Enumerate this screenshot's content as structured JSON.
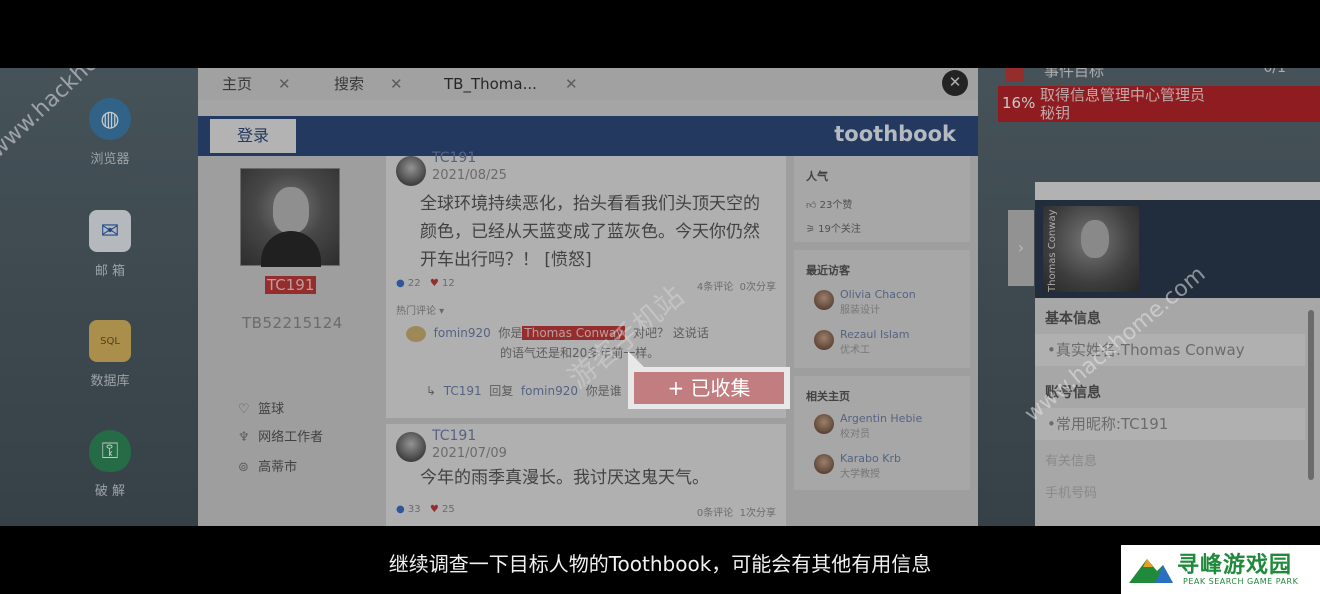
{
  "desktop": {
    "icons": [
      {
        "label": "浏览器"
      },
      {
        "label": "邮 箱"
      },
      {
        "label": "数据库"
      },
      {
        "label": "破 解"
      }
    ]
  },
  "browser": {
    "tabs": [
      {
        "label": "主页"
      },
      {
        "label": "搜索"
      },
      {
        "label": "TB_Thoma..."
      }
    ],
    "close_symbol": "✕",
    "login_label": "登录",
    "brand": "toothbook"
  },
  "profile": {
    "username": "TC191",
    "user_id": "TB52215124",
    "attributes": [
      {
        "icon": "heart-icon",
        "glyph": "♡",
        "label": "篮球"
      },
      {
        "icon": "tie-icon",
        "glyph": "♆",
        "label": "网络工作者"
      },
      {
        "icon": "location-icon",
        "glyph": "⊚",
        "label": "高蒂市"
      }
    ]
  },
  "posts": [
    {
      "author": "TC191",
      "date": "2021/08/25",
      "text": "全球环境持续恶化，抬头看看我们头顶天空的颜色，已经从天蓝变成了蓝灰色。今天你仍然开车出行吗？！ [愤怒]",
      "likes": "22",
      "hearts": "12",
      "comments": "4条评论",
      "shares": "0次分享",
      "hot_label": "热门评论 ▾",
      "comment": {
        "user": "fomin920",
        "pre": "你是",
        "highlight": "Thomas Conway",
        "post": "对吧？ 这说话",
        "line2": "的语气还是和20多年前一样。"
      },
      "reply": {
        "user": "TC191",
        "verb": "回复",
        "target": "fomin920",
        "text": "你是谁"
      }
    },
    {
      "author": "TC191",
      "date": "2021/07/09",
      "text": "今年的雨季真漫长。我讨厌这鬼天气。",
      "likes": "33",
      "hearts": "25",
      "comments": "0条评论",
      "shares": "1次分享"
    }
  ],
  "sidebar": {
    "popularity": {
      "title": "人气",
      "likes": "23个赞",
      "follows": "19个关注"
    },
    "recent_visitors": {
      "title": "最近访客",
      "people": [
        {
          "name": "Olivia Chacon",
          "role": "服装设计"
        },
        {
          "name": "Rezaul Islam",
          "role": "优术工"
        }
      ]
    },
    "related": {
      "title": "相关主页",
      "people": [
        {
          "name": "Argentin Hebie",
          "role": "校对员"
        },
        {
          "name": "Karabo Krb",
          "role": "大学教授"
        }
      ]
    }
  },
  "popup": {
    "label": "+ 已收集"
  },
  "task": {
    "title": "事件目标",
    "count": "0/1",
    "progress": "16%",
    "description_line1": "取得信息管理中心管理员",
    "description_line2": "秘钥"
  },
  "info_panel": {
    "vertical_name": "Thomas Conway",
    "section_basic": "基本信息",
    "real_name": "•真实姓名:Thomas Conway",
    "section_account": "账号信息",
    "nickname": "•常用昵称:TC191",
    "faint1": "有关信息",
    "faint2": "手机号码"
  },
  "watermarks": {
    "site": "www.hackhome.com",
    "center": "游客手机站"
  },
  "subtitle": "继续调查一下目标人物的Toothbook，可能会有其他有用信息",
  "logo": {
    "zh": "寻峰游戏园",
    "en": "PEAK SEARCH GAME PARK"
  },
  "colors": {
    "accent_red": "#c03a3a",
    "header_blue": "#2f4a7a",
    "link_blue": "#6d7fa8",
    "logo_green": "#1f8a3a"
  }
}
